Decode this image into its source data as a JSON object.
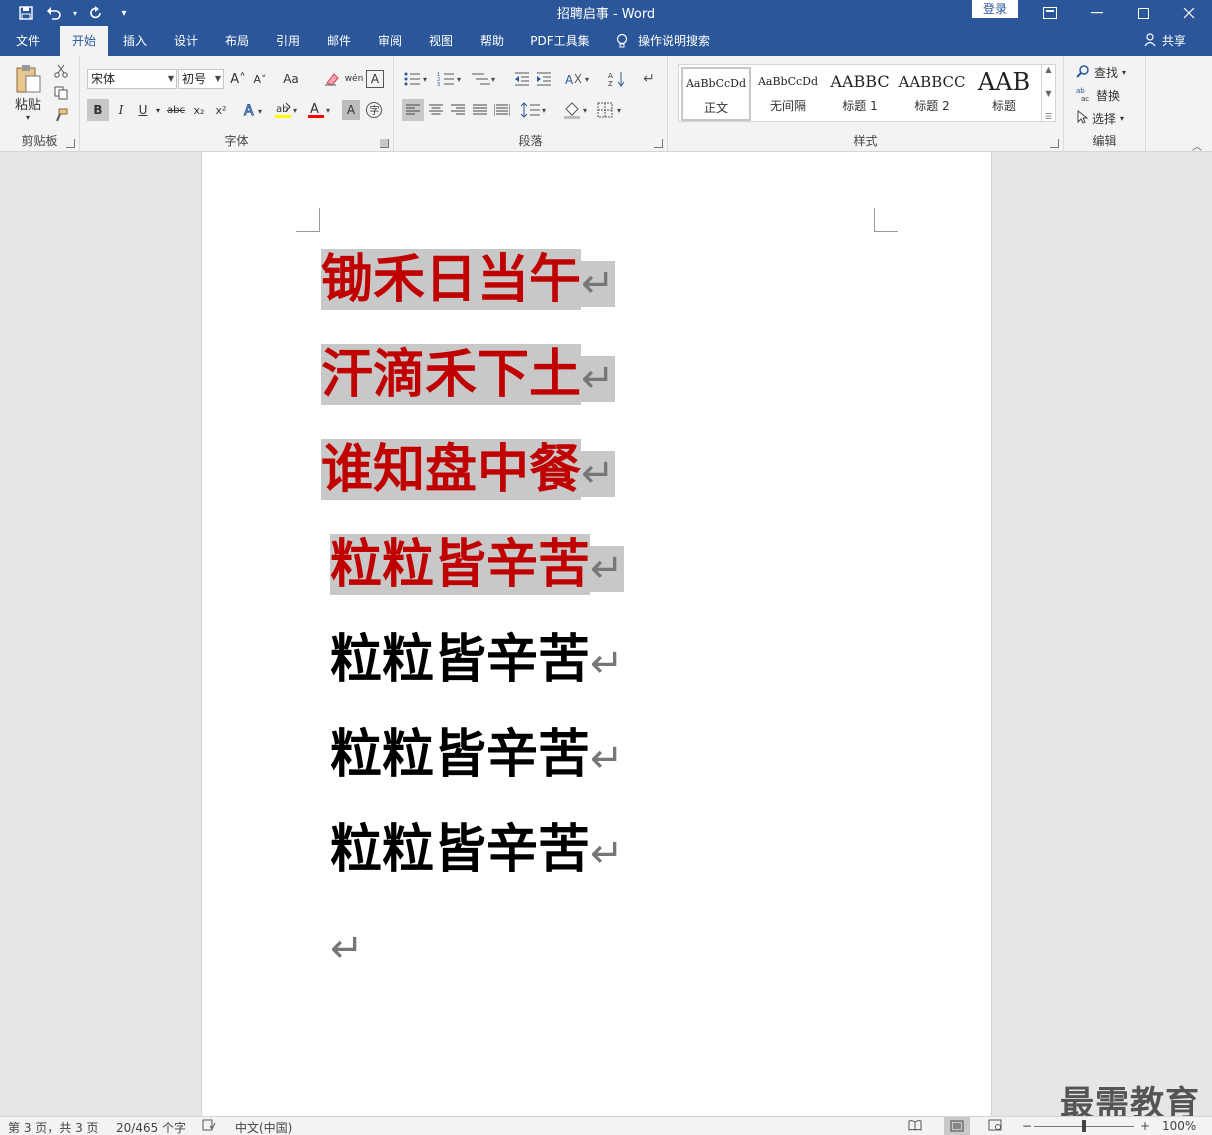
{
  "window": {
    "title": "招聘启事  -  Word",
    "login": "登录",
    "qat": {
      "save_icon": "save-icon",
      "undo_icon": "undo-icon",
      "redo_icon": "redo-icon",
      "customize": "▾"
    }
  },
  "tabs": [
    "文件",
    "开始",
    "插入",
    "设计",
    "布局",
    "引用",
    "邮件",
    "审阅",
    "视图",
    "帮助",
    "PDF工具集"
  ],
  "active_tab": "开始",
  "tell_me": "操作说明搜索",
  "share": "共享",
  "ribbon": {
    "clipboard": {
      "label": "剪贴板",
      "paste": "粘贴"
    },
    "font": {
      "label": "字体",
      "font_name": "宋体",
      "font_size": "初号",
      "bold": "B",
      "italic": "I",
      "underline": "U",
      "strike": "abc",
      "sub": "x₂",
      "sup": "x²",
      "grow": "A˄",
      "shrink": "A˅",
      "case": "Aa",
      "phonetic": "wén",
      "border_char": "A"
    },
    "paragraph": {
      "label": "段落"
    },
    "styles": {
      "label": "样式",
      "items": [
        {
          "sample": "AaBbCcDd",
          "name": "正文"
        },
        {
          "sample": "AaBbCcDd",
          "name": "无间隔"
        },
        {
          "sample": "AABBC",
          "name": "标题 1"
        },
        {
          "sample": "AABBCC",
          "name": "标题 2"
        },
        {
          "sample": "AAB",
          "name": "标题"
        }
      ]
    },
    "editing": {
      "label": "编辑",
      "find": "查找",
      "replace": "替换",
      "select": "选择"
    }
  },
  "document": {
    "lines": [
      {
        "text": "锄禾日当午",
        "color": "#c00000",
        "highlight": true
      },
      {
        "text": "汗滴禾下土",
        "color": "#c00000",
        "highlight": true
      },
      {
        "text": "谁知盘中餐",
        "color": "#c00000",
        "highlight": true
      },
      {
        "text": "粒粒皆辛苦",
        "color": "#c00000",
        "highlight": true
      },
      {
        "text": "粒粒皆辛苦",
        "color": "#000000",
        "highlight": false
      },
      {
        "text": "粒粒皆辛苦",
        "color": "#000000",
        "highlight": false
      },
      {
        "text": "粒粒皆辛苦",
        "color": "#000000",
        "highlight": false
      },
      {
        "text": "",
        "color": "#000000",
        "highlight": false
      }
    ],
    "paragraph_mark": "↵"
  },
  "statusbar": {
    "page": "第 3 页，共 3 页",
    "words": "20/465 个字",
    "language": "中文(中国)",
    "zoom": "100%"
  },
  "watermark": "最需教育",
  "colors": {
    "brand": "#2b579a",
    "text_red": "#c00000",
    "highlight": "#c8c8c8"
  }
}
